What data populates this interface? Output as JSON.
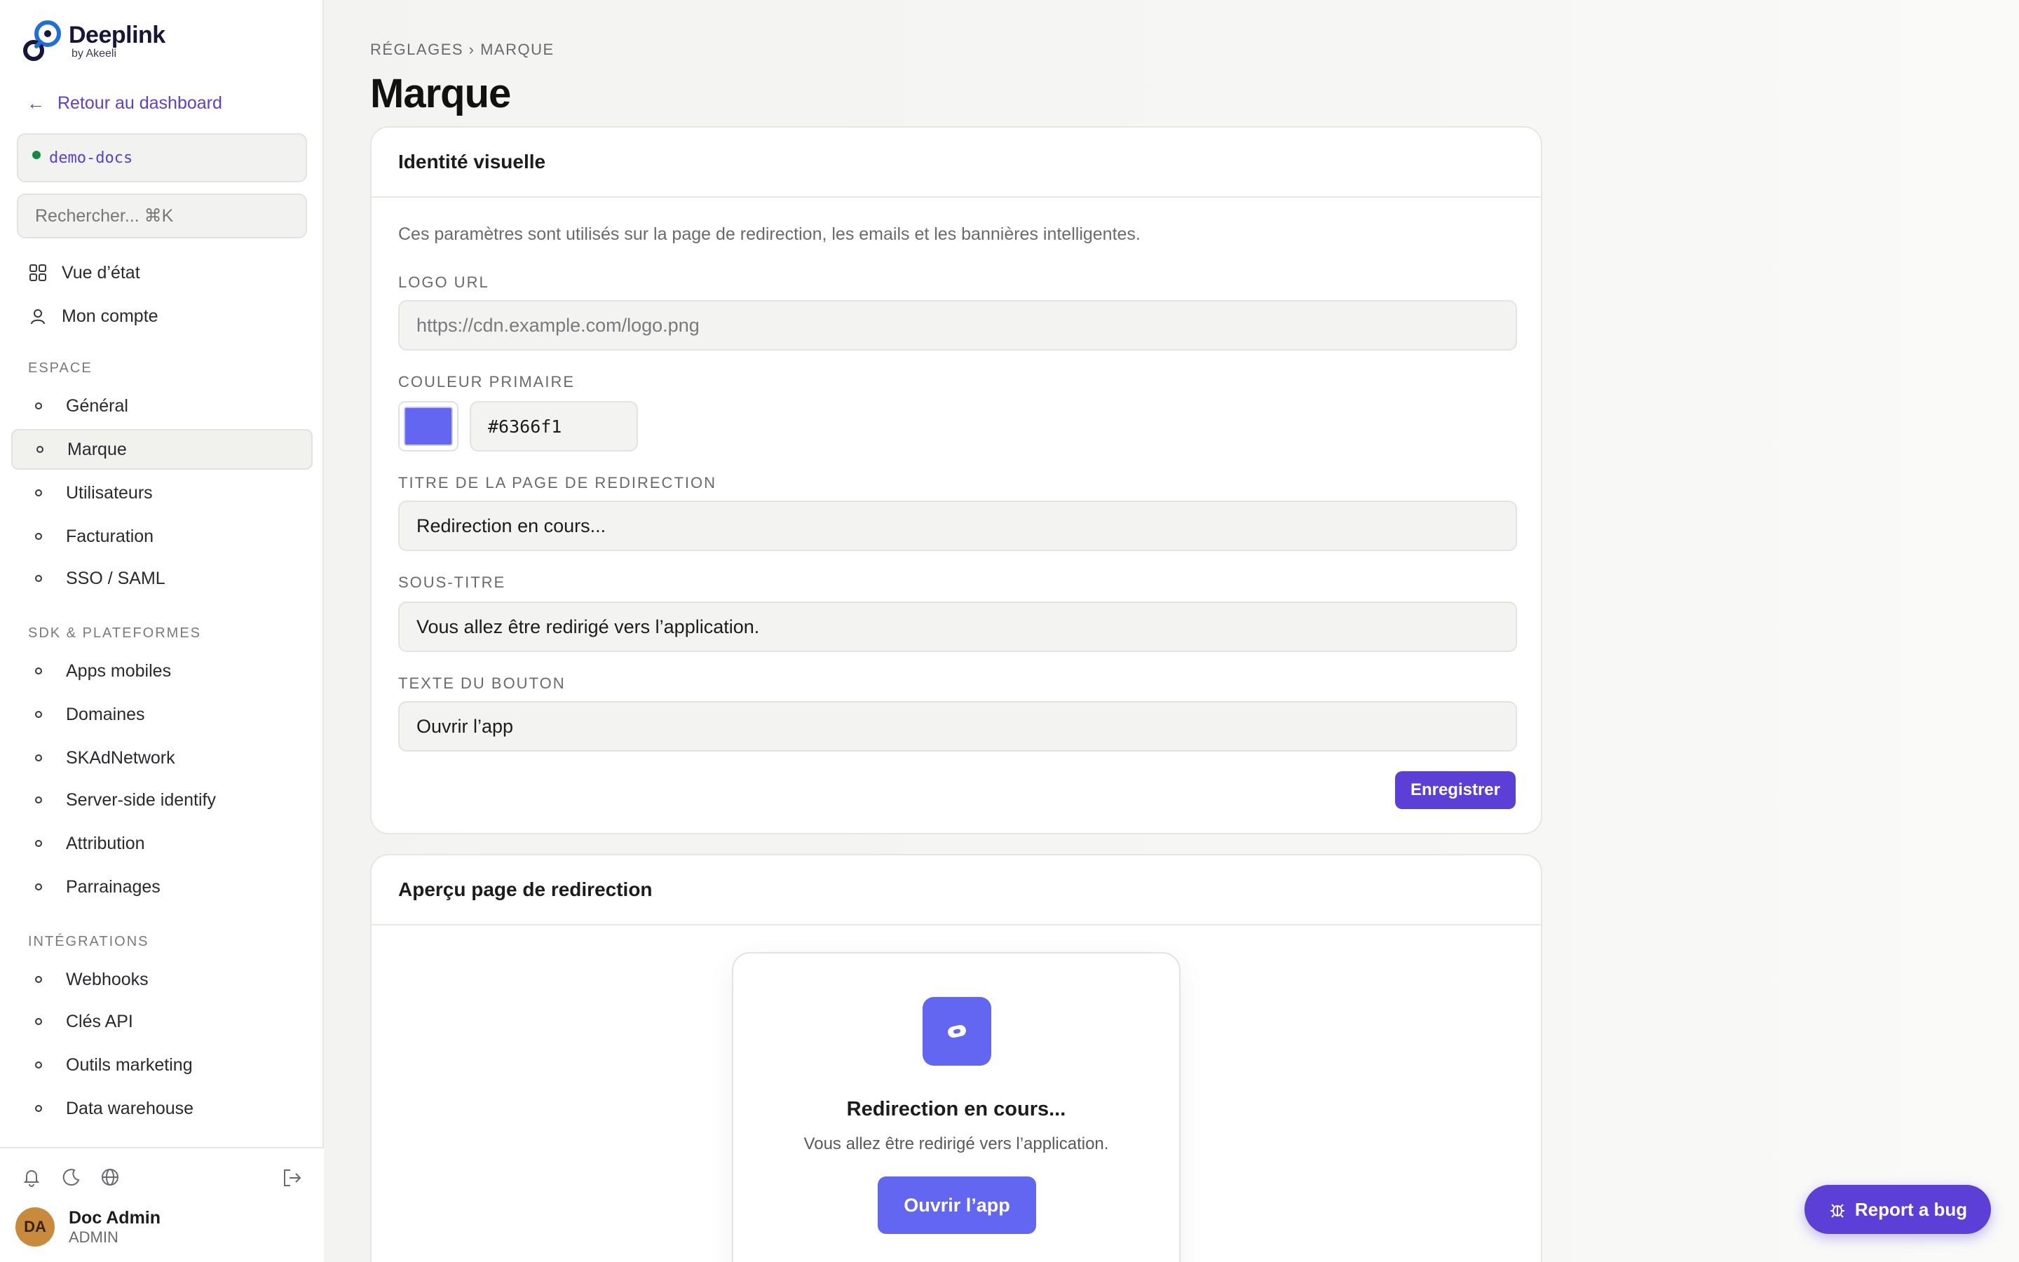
{
  "brand": {
    "name": "Deeplink",
    "sub": "by Akeeli",
    "accent": "#5b3fd6"
  },
  "sidebar": {
    "back_label": "Retour au dashboard",
    "workspace": "demo-docs",
    "search_placeholder": "Rechercher... ⌘K",
    "top_items": [
      {
        "label": "Vue d’état",
        "icon": "grid-icon"
      },
      {
        "label": "Mon compte",
        "icon": "user-icon"
      }
    ],
    "sections": [
      {
        "label": "ESPACE",
        "items": [
          "Général",
          "Marque",
          "Utilisateurs",
          "Facturation",
          "SSO / SAML"
        ]
      },
      {
        "label": "SDK & PLATEFORMES",
        "items": [
          "Apps mobiles",
          "Domaines",
          "SKAdNetwork",
          "Server-side identify",
          "Attribution",
          "Parrainages"
        ]
      },
      {
        "label": "INTÉGRATIONS",
        "items": [
          "Webhooks",
          "Clés API",
          "Outils marketing",
          "Data warehouse"
        ]
      }
    ],
    "active_item": "Marque",
    "user": {
      "initials": "DA",
      "name": "Doc Admin",
      "role": "ADMIN"
    }
  },
  "main": {
    "breadcrumb": "RÉGLAGES › MARQUE",
    "title": "Marque",
    "identity_card": {
      "title": "Identité visuelle",
      "description": "Ces paramètres sont utilisés sur la page de redirection, les emails et les bannières intelligentes.",
      "logo_label": "LOGO URL",
      "logo_placeholder": "https://cdn.example.com/logo.png",
      "color_label": "COULEUR PRIMAIRE",
      "color_value": "#6366f1",
      "redirect_title_label": "TITRE DE LA PAGE DE REDIRECTION",
      "redirect_title_value": "Redirection en cours...",
      "subtitle_label": "SOUS-TITRE",
      "subtitle_value": "Vous allez être redirigé vers l’application.",
      "button_text_label": "TEXTE DU BOUTON",
      "button_text_value": "Ouvrir l’app",
      "save_label": "Enregistrer"
    },
    "preview_card": {
      "title": "Aperçu page de redirection",
      "preview_title": "Redirection en cours...",
      "preview_subtitle": "Vous allez être redirigé vers l’application.",
      "preview_button": "Ouvrir l’app"
    }
  },
  "report_bug_label": "Report a bug"
}
